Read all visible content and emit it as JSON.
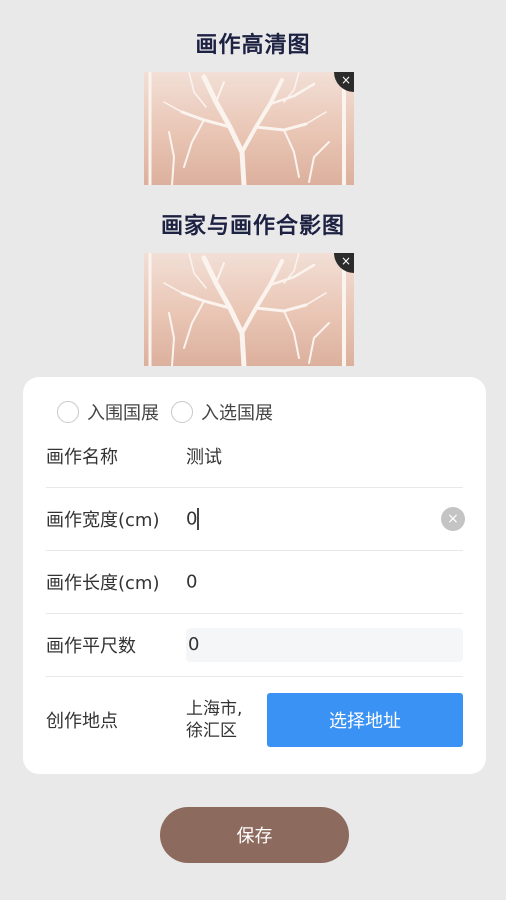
{
  "sections": {
    "hd_title": "画作高清图",
    "photo_title": "画家与画作合影图",
    "remove_icon": "×"
  },
  "form": {
    "radios": [
      {
        "label": "入围国展",
        "checked": false
      },
      {
        "label": "入选国展",
        "checked": false
      }
    ],
    "name": {
      "label": "画作名称",
      "value": "测试"
    },
    "width": {
      "label": "画作宽度(cm)",
      "value": "0",
      "clear_icon": "×"
    },
    "length": {
      "label": "画作长度(cm)",
      "value": "0"
    },
    "area": {
      "label": "画作平尺数",
      "value": "0"
    },
    "location": {
      "label": "创作地点",
      "value": "上海市,徐汇区",
      "button_label": "选择地址"
    }
  },
  "save_label": "保存",
  "colors": {
    "background": "#e9e9e9",
    "primary_blue": "#3a92f4",
    "save_brown": "#8c6a5d",
    "title_navy": "#1d2142"
  }
}
